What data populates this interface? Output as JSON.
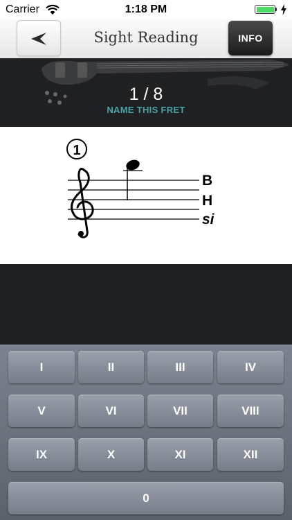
{
  "status_bar": {
    "carrier": "Carrier",
    "time": "1:18 PM",
    "battery_color": "#4cd964"
  },
  "nav": {
    "back_icon": "back-arrow-icon",
    "title": "Sight Reading",
    "info_label": "INFO"
  },
  "header": {
    "progress": "1 / 8",
    "prompt": "NAME THIS FRET"
  },
  "staff": {
    "string_number": "1",
    "clef": "treble",
    "string_labels": [
      "B",
      "H",
      "si"
    ]
  },
  "keypad": {
    "keys": [
      "I",
      "II",
      "III",
      "IV",
      "V",
      "VI",
      "VII",
      "VIII",
      "IX",
      "X",
      "XI",
      "XII"
    ],
    "zero": "0"
  },
  "colors": {
    "prompt": "#4aa3a8",
    "keypad": "#7d8290"
  }
}
